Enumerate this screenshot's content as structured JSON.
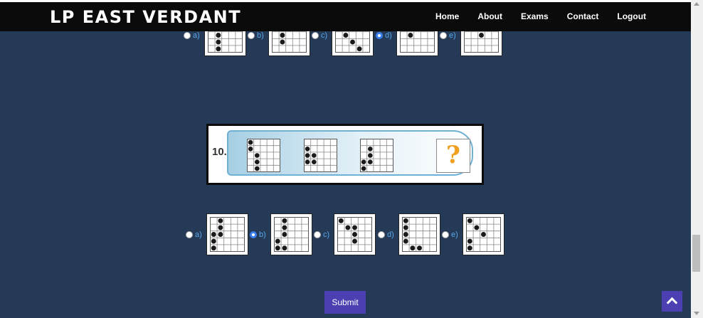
{
  "navbar": {
    "brand": "LP EAST VERDANT",
    "items": [
      {
        "label": "Home",
        "active": true
      },
      {
        "label": "About",
        "active": false
      },
      {
        "label": "Exams",
        "active": false
      },
      {
        "label": "Contact",
        "active": false
      },
      {
        "label": "Logout",
        "active": false
      }
    ]
  },
  "question9": {
    "options": [
      {
        "letter": "a)",
        "checked": false,
        "dots": [
          [
            1,
            1
          ],
          [
            2,
            1
          ],
          [
            3,
            1
          ],
          [
            4,
            1
          ]
        ]
      },
      {
        "letter": "b)",
        "checked": false,
        "dots": [
          [
            1,
            1
          ],
          [
            2,
            1
          ],
          [
            3,
            1
          ]
        ]
      },
      {
        "letter": "c)",
        "checked": false,
        "dots": [
          [
            1,
            1
          ],
          [
            2,
            1
          ],
          [
            3,
            2
          ],
          [
            4,
            3
          ]
        ]
      },
      {
        "letter": "d)",
        "checked": true,
        "dots": [
          [
            0,
            1
          ],
          [
            1,
            1
          ],
          [
            2,
            1
          ]
        ]
      },
      {
        "letter": "e)",
        "checked": false,
        "dots": [
          [
            0,
            0
          ],
          [
            1,
            1
          ],
          [
            2,
            2
          ]
        ]
      }
    ]
  },
  "question10": {
    "number": "10.",
    "sequence": [
      [
        [
          0,
          0
        ],
        [
          1,
          0
        ],
        [
          2,
          1
        ],
        [
          3,
          1
        ],
        [
          4,
          1
        ]
      ],
      [
        [
          1,
          0
        ],
        [
          2,
          0
        ],
        [
          2,
          1
        ],
        [
          3,
          0
        ],
        [
          3,
          1
        ]
      ],
      [
        [
          1,
          1
        ],
        [
          2,
          1
        ],
        [
          3,
          0
        ],
        [
          3,
          1
        ],
        [
          4,
          0
        ]
      ]
    ],
    "unknown": "?",
    "options": [
      {
        "letter": "a)",
        "checked": false,
        "dots": [
          [
            0,
            1
          ],
          [
            1,
            1
          ],
          [
            2,
            0
          ],
          [
            2,
            1
          ],
          [
            3,
            0
          ],
          [
            4,
            0
          ]
        ]
      },
      {
        "letter": "b)",
        "checked": true,
        "dots": [
          [
            0,
            1
          ],
          [
            1,
            1
          ],
          [
            2,
            1
          ],
          [
            3,
            0
          ],
          [
            4,
            0
          ],
          [
            4,
            1
          ]
        ]
      },
      {
        "letter": "c)",
        "checked": false,
        "dots": [
          [
            0,
            0
          ],
          [
            1,
            1
          ],
          [
            1,
            2
          ],
          [
            2,
            2
          ],
          [
            3,
            2
          ]
        ]
      },
      {
        "letter": "d)",
        "checked": false,
        "dots": [
          [
            0,
            0
          ],
          [
            1,
            0
          ],
          [
            2,
            0
          ],
          [
            3,
            0
          ],
          [
            4,
            1
          ],
          [
            4,
            2
          ]
        ]
      },
      {
        "letter": "e)",
        "checked": false,
        "dots": [
          [
            0,
            0
          ],
          [
            1,
            1
          ],
          [
            2,
            2
          ],
          [
            3,
            0
          ],
          [
            4,
            0
          ]
        ]
      }
    ]
  },
  "submit_label": "Submit",
  "colors": {
    "background": "#243a57",
    "navbar": "#0b0b0b",
    "accent": "#4b3fb1",
    "option_letter": "#5aa8ea",
    "question_mark": "#f0a020"
  },
  "icons": {
    "back_to_top": "chevron-up-icon"
  }
}
